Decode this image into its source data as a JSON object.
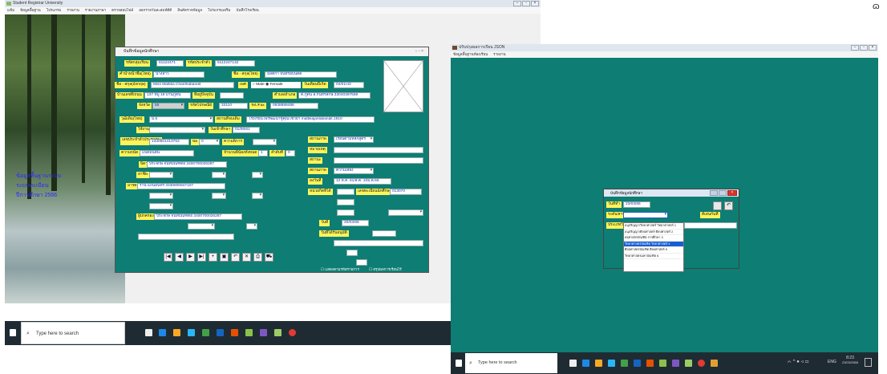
{
  "screen1": {
    "title": "Student Registrar University",
    "menu": [
      "แฟ้ม",
      "ข้อมูลพื้นฐาน",
      "โปรแกรม",
      "รายงาน",
      "รายงานภาษา",
      "ตรวจสอบไฟล์",
      "ออกรายวันสะสมท์ดีดี",
      "ลินค์ตรวจข้อมูล",
      "โปรแกรมเสริม",
      "บันทึกโรงเรียน"
    ],
    "left_overlay": [
      "ข้อมูลพื้นฐานระบบ",
      "ระบบทะเบียน",
      "ปีการศึกษา 2566"
    ],
    "taskbar_search": "Type here to search"
  },
  "form": {
    "title": "บันทึกข้อมูลนักศึกษา",
    "fields": [
      {
        "label": "รหัสกลุ่มเรียน",
        "value": "61122471"
      },
      {
        "label": "รหัสประจำตัว",
        "value": "6112247132"
      },
      {
        "label": "คำนำหน้าชื่อ(ไทย)",
        "value": "นางสาว"
      },
      {
        "label": "ชื่อ - สกุล(ไทย)",
        "value": "มัลติกา จันทรอับนดิต"
      },
      {
        "label": "ชื่อ - สกุล(อังกฤษ)",
        "value": "Miss Mattika Chanthabandit"
      },
      {
        "label": "เพศ",
        "value": "Female"
      },
      {
        "label": "วันเดือนปีเกิด",
        "value": "04/01/43"
      },
      {
        "label": "บ้านเลขที่/ถนน",
        "value": "137 หมู่ 19 บ้านภูดิน"
      },
      {
        "label": "ที่อยู่ปัจจุบัน",
        "value": ""
      },
      {
        "label": "ตำบล/อำเภอ",
        "value": "ต.ภูดิน อ.กันทรลักษ์ 33040397559"
      },
      {
        "label": "จังหวัด",
        "value": "55"
      },
      {
        "label": "รหัสไปรษณีย์",
        "value": "33110"
      },
      {
        "label": "Tel./Fax",
        "value": "0838889486"
      },
      {
        "label": "วุฒิเดิม(ไทย)",
        "value": "ม.6"
      },
      {
        "label": "สถานที่จบเดิม",
        "value": "โรงเรียนไพรพัฒนาชูคุณโชว์ยา mattikajantabandit.1910"
      },
      {
        "label": "ใช้งาน",
        "value": ""
      },
      {
        "label": "วันเข้าศึกษา",
        "value": "01/06/61"
      },
      {
        "label": "เลขประจำตัวประชาชน",
        "value": "1330501413753"
      },
      {
        "label": "พ่อ",
        "value": "0"
      },
      {
        "label": "ความพิการ",
        "value": ""
      },
      {
        "label": "ความถนัด",
        "value": "แบดมินตัน"
      },
      {
        "label": "จำนวนพี่น้องทั้งหมด",
        "value": "1"
      },
      {
        "label": "ลำดับที่",
        "value": "0"
      },
      {
        "label": "บิดา",
        "value": "ประจักษ์ จันทบัณฑิตย์ 3400700026287"
      },
      {
        "label": "มารดา",
        "value": "รานี แถนอินทร์ 3330800847107"
      },
      {
        "label": "ผู้ปกครอง",
        "value": "ประจักษ์ จันทบัณฑิตย์ 3400700026287"
      },
      {
        "label": "สถานภาพ",
        "value": "เรียนตามหลักสูตร"
      },
      {
        "label": "หมายเหตุ",
        "value": ""
      },
      {
        "label": "สถานะ",
        "value": ""
      },
      {
        "label": "สถานภาพ",
        "value": "ความเสี่ยง"
      },
      {
        "label": "ลงวันที่",
        "value": "12 ต.ค. 61/ส.ค. 10ม.ค.66"
      },
      {
        "label": "หน่วยกิตที่ได้",
        "value": ""
      },
      {
        "label": "เลขทะเบียนนักศึกษา",
        "value": "013070"
      },
      {
        "label": "วันที่",
        "value": "20/03/66"
      },
      {
        "label": "วันที่ได้รับอนุมัติ",
        "value": "/ /"
      }
    ],
    "gender_options": [
      "Male",
      "Female"
    ],
    "nav_buttons": [
      "|◀",
      "◀",
      "▶",
      "▶|",
      "+",
      "▣",
      "↶",
      "✕",
      "⎙",
      "⛟"
    ],
    "checkbox1": "แสดงตามรหัสรายการ",
    "checkbox2": "สรุปผลการเรียนไร้"
  },
  "screen2": {
    "title": "ปรับปรุงผลการเรียน JSON",
    "menu": [
      "ข้อมูลพื้นฐานห้องเรียน",
      "รายงาน"
    ],
    "dialog_title": "บันทึกข้อมูลนักศึกษา",
    "dialog_date_label": "วันที่ทำ",
    "dialog_date": "23/03/66",
    "dialog_level_label": "ระดับ/สาขา",
    "dialog_type_label": "ประเภทวิชา",
    "dialog_right_label": "ดีเด่นกันที่",
    "list": [
      {
        "name": "อนุปริญญา/วิทยาศาสตร์",
        "field": "วิทยาศาสตร์",
        "code": "1"
      },
      {
        "name": "อนุปริญญา/ศิลปศาสตร์",
        "field": "ศิลปศาสตร์",
        "code": "2"
      },
      {
        "name": "ครุศาสตรบัณฑิต",
        "field": "การศึกษา",
        "code": "3"
      },
      {
        "name": "วิทยาศาสตรบัณฑิต",
        "field": "วิทยาศาสตร์",
        "code": "4"
      },
      {
        "name": "ศิลปศาสตรบัณฑิต",
        "field": "ศิลปศาสตร์",
        "code": "5"
      },
      {
        "name": "วิทยาศาสตรมหาบัณฑิต",
        "field": "",
        "code": "6"
      }
    ],
    "taskbar_search": "Type here to search",
    "tray_lang": "ENG",
    "clock_time": "8:23",
    "clock_date": "23/03/2566"
  }
}
